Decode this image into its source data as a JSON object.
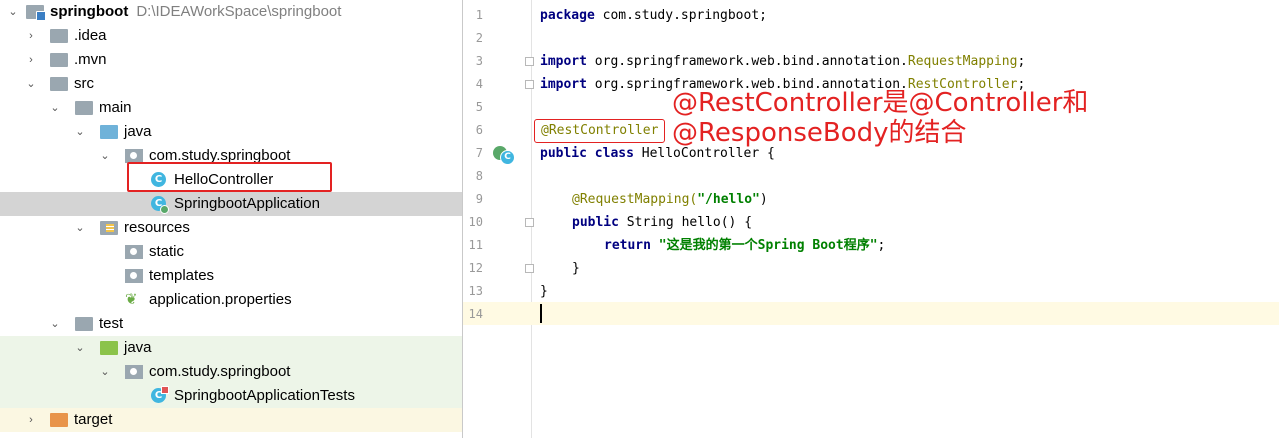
{
  "project_tree": {
    "root": {
      "name": "springboot",
      "path": "D:\\IDEAWorkSpace\\springboot"
    },
    "items": [
      {
        "label": ".idea"
      },
      {
        "label": ".mvn"
      },
      {
        "label": "src"
      },
      {
        "label": "main"
      },
      {
        "label": "java"
      },
      {
        "label": "com.study.springboot"
      },
      {
        "label": "HelloController"
      },
      {
        "label": "SpringbootApplication"
      },
      {
        "label": "resources"
      },
      {
        "label": "static"
      },
      {
        "label": "templates"
      },
      {
        "label": "application.properties"
      },
      {
        "label": "test"
      },
      {
        "label": "java"
      },
      {
        "label": "com.study.springboot"
      },
      {
        "label": "SpringbootApplicationTests"
      },
      {
        "label": "target"
      }
    ],
    "class_icon_letter": "C"
  },
  "editor": {
    "line_numbers": [
      "1",
      "2",
      "3",
      "4",
      "5",
      "6",
      "7",
      "8",
      "9",
      "10",
      "11",
      "12",
      "13",
      "14"
    ],
    "lines": {
      "l1_kw": "package",
      "l1_rest": " com.study.springboot;",
      "l3_kw": "import",
      "l3_pkg": " org.springframework.web.bind.annotation.",
      "l3_cls": "RequestMapping",
      "l3_end": ";",
      "l4_kw": "import",
      "l4_pkg": " org.springframework.web.bind.annotation.",
      "l4_cls": "RestController",
      "l4_end": ";",
      "l6_ann": "@RestController",
      "l7_kw": "public class",
      "l7_rest": " HelloController {",
      "l9_ann": "@RequestMapping(",
      "l9_str": "\"/hello\"",
      "l9_end": ")",
      "l10_kw": "public",
      "l10_rest": " String hello() {",
      "l11_kw": "return",
      "l11_str": " \"这是我的第一个Spring Boot程序\"",
      "l11_end": ";",
      "l12": "}",
      "l13": "}"
    },
    "callout": "@RestController是@Controller和@ResponseBody的结合"
  },
  "colors": {
    "keyword": "#000080",
    "annotation": "#808000",
    "string": "#008000",
    "highlight": "#e32222",
    "selection": "#d4d4d4"
  }
}
